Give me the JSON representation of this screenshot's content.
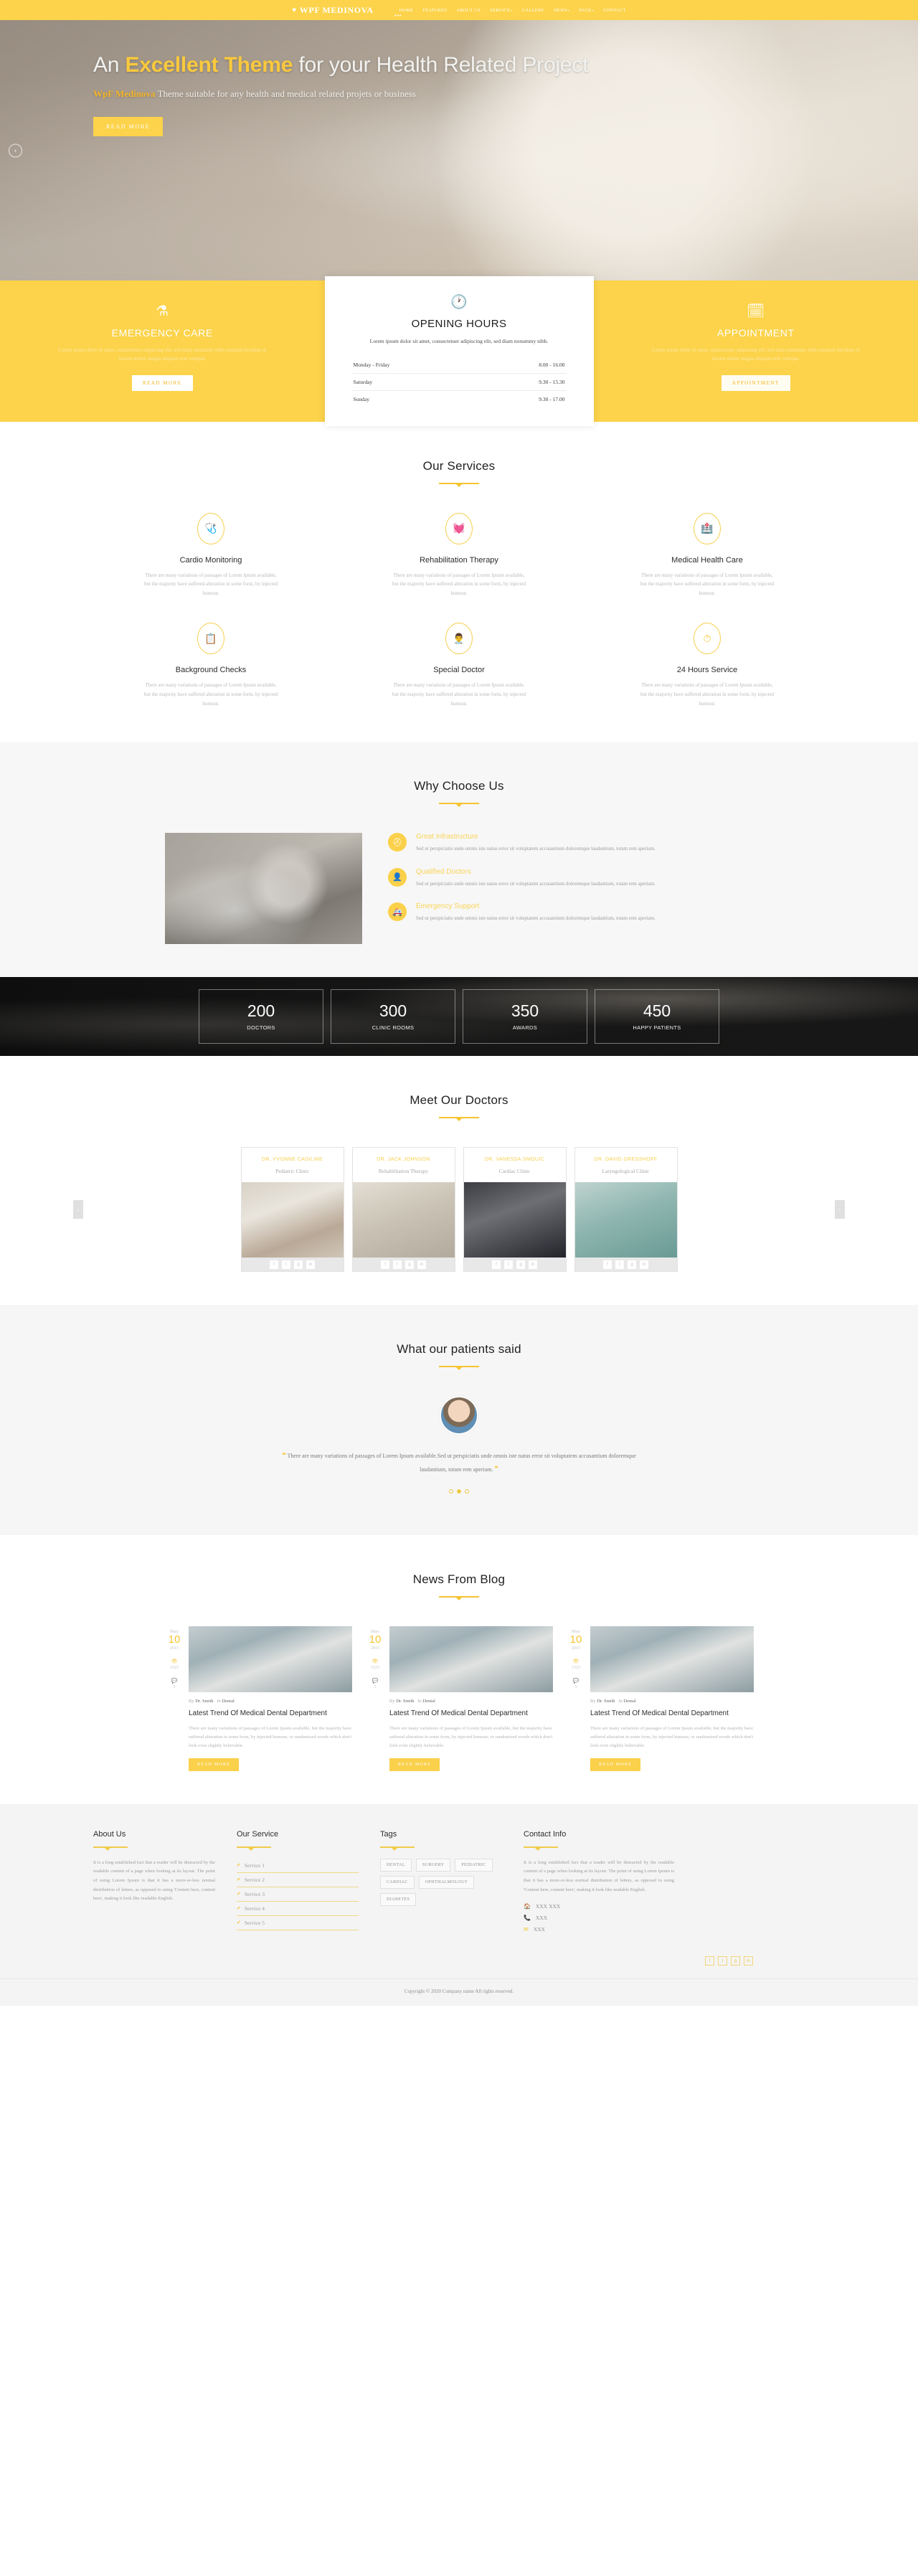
{
  "header": {
    "brand": "WPF MEDINOVA",
    "brand_icon": "heart-pulse-icon",
    "nav": [
      {
        "label": "HOME",
        "caret": false
      },
      {
        "label": "FEATURES",
        "caret": false
      },
      {
        "label": "ABOUT US",
        "caret": false
      },
      {
        "label": "SERVICE",
        "caret": true
      },
      {
        "label": "GALLERY",
        "caret": false
      },
      {
        "label": "NEWS",
        "caret": true
      },
      {
        "label": "PAGE",
        "caret": true
      },
      {
        "label": "CONTACT",
        "caret": false
      }
    ],
    "dots": "•••"
  },
  "hero": {
    "title_pre": "An ",
    "title_hl": "Excellent Theme",
    "title_post": " for your Health Related Project",
    "sub_hl": "WpF Medinova",
    "sub_rest": " Theme suitable for any health and medical related projets or business",
    "cta": "READ MORE",
    "prev_arrow": "‹"
  },
  "info": {
    "emergency": {
      "icon": "flask-icon",
      "title": "EMERGENCY CARE",
      "text": "Lorem ipsum dolor sit amet, consectetuer adipiscing elit, sed diam nonummy nibh euismod tincidunt ut laoreet dolore magna aliquam erat volutpat.",
      "button": "READ MORE"
    },
    "hours": {
      "icon": "clock-icon",
      "title": "OPENING HOURS",
      "text": "Lorem ipsum dolor sit amet, consectetuer adipiscing elit, sed diam nonummy nibh.",
      "rows": [
        {
          "day": "Monday - Friday",
          "time": "8.00 - 16.00"
        },
        {
          "day": "Saturday",
          "time": "9.30 - 15.30"
        },
        {
          "day": "Sunday",
          "time": "9.30 - 17.00"
        }
      ]
    },
    "appointment": {
      "icon": "calendar-icon",
      "title": "APPOINTMENT",
      "text": "Lorem ipsum dolor sit amet, consectetuer adipiscing elit, sed diam nonummy nibh euismod tincidunt ut laoreet dolore magna aliquam erat volutpat.",
      "button": "APPOINTMENT"
    }
  },
  "services": {
    "title": "Our Services",
    "items": [
      {
        "icon": "stethoscope-icon",
        "title": "Cardio Monitoring",
        "text": "There are many variations of passages of Lorem Ipsum available, but the majority have suffered alteration in some form, by injected humour."
      },
      {
        "icon": "heartbeat-icon",
        "title": "Rehabilitation Therapy",
        "text": "There are many variations of passages of Lorem Ipsum available, but the majority have suffered alteration in some form, by injected humour."
      },
      {
        "icon": "hospital-icon",
        "title": "Medical Health Care",
        "text": "There are many variations of passages of Lorem Ipsum available, but the majority have suffered alteration in some form, by injected humour."
      },
      {
        "icon": "clipboard-check-icon",
        "title": "Background Checks",
        "text": "There are many variations of passages of Lorem Ipsum available, but the majority have suffered alteration in some form, by injected humour."
      },
      {
        "icon": "user-md-icon",
        "title": "Special Doctor",
        "text": "There are many variations of passages of Lorem Ipsum available, but the majority have suffered alteration in some form, by injected humour."
      },
      {
        "icon": "clock-24-icon",
        "title": "24 Hours Service",
        "text": "There are many variations of passages of Lorem Ipsum available, but the majority have suffered alteration in some form, by injected humour."
      }
    ]
  },
  "why": {
    "title": "Why Choose Us",
    "items": [
      {
        "icon": "first-aid-kit-icon",
        "title": "Great Infrastructure",
        "text": "Sed ut perspiciatis unde omnis iste natus error sit voluptatem accusantium doloremque laudantium, totam rem aperiam."
      },
      {
        "icon": "doctor-badge-icon",
        "title": "Qualified Doctors",
        "text": "Sed ut perspiciatis unde omnis iste natus error sit voluptatem accusantium doloremque laudantium, totam rem aperiam."
      },
      {
        "icon": "ambulance-icon",
        "title": "Emergency Support",
        "text": "Sed ut perspiciatis unde omnis iste natus error sit voluptatem accusantium doloremque laudantium, totam rem aperiam."
      }
    ]
  },
  "counters": [
    {
      "number": "200",
      "label": "DOCTORS"
    },
    {
      "number": "300",
      "label": "CLINIC ROOMS"
    },
    {
      "number": "350",
      "label": "AWARDS"
    },
    {
      "number": "450",
      "label": "HAPPY PATIENTS"
    }
  ],
  "doctors": {
    "title": "Meet Our Doctors",
    "prev": "‹",
    "next": "›",
    "items": [
      {
        "name": "DR. YVONNE CADILINE",
        "specialty": "Pediatric Clinic"
      },
      {
        "name": "DR. JACK JOHNSON",
        "specialty": "Rehabilitation Therapy"
      },
      {
        "name": "DR. VANESSA SMOUIC",
        "specialty": "Cardiac Clinic"
      },
      {
        "name": "DR. DAVID GRESSHOFF",
        "specialty": "Laryngological Clinic"
      }
    ],
    "social": [
      "f",
      "t",
      "g",
      "in"
    ]
  },
  "testimonial": {
    "title": "What our patients said",
    "avatar": "patient-avatar",
    "quote_open": "❝",
    "quote": "There are many variations of passages of Lorem Ipsum available.Sed ut perspiciatis unde omnis iste natus error sit voluptatem accusantium doloremque laudantium, totam rem aperiam.",
    "quote_close": "❞",
    "dots": 3,
    "active_dot": 1
  },
  "blog": {
    "title": "News From Blog",
    "posts": [
      {
        "month": "May",
        "day": "10",
        "year": "2015",
        "views_icon": "eye-icon",
        "views": "1523",
        "comments_icon": "comment-icon",
        "comments": "5",
        "by_label": "By",
        "author": "Dr. Smith",
        "in_label": "In",
        "category": "Dental",
        "title": "Latest Trend Of Medical Dental Department",
        "text": "There are many variations of passages of Lorem Ipsum available, but the majority have suffered alteration in some form, by injected humour, or randomised words which don't look even slightly believable.",
        "button": "READ MORE"
      },
      {
        "month": "May",
        "day": "10",
        "year": "2015",
        "views_icon": "eye-icon",
        "views": "1523",
        "comments_icon": "comment-icon",
        "comments": "5",
        "by_label": "By",
        "author": "Dr. Smith",
        "in_label": "In",
        "category": "Dental",
        "title": "Latest Trend Of Medical Dental Department",
        "text": "There are many variations of passages of Lorem Ipsum available, but the majority have suffered alteration in some form, by injected humour, or randomised words which don't look even slightly believable.",
        "button": "READ MORE"
      },
      {
        "month": "May",
        "day": "10",
        "year": "2015",
        "views_icon": "eye-icon",
        "views": "1523",
        "comments_icon": "comment-icon",
        "comments": "5",
        "by_label": "By",
        "author": "Dr. Smith",
        "in_label": "In",
        "category": "Dental",
        "title": "Latest Trend Of Medical Dental Department",
        "text": "There are many variations of passages of Lorem Ipsum available, but the majority have suffered alteration in some form, by injected humour, or randomised words which don't look even slightly believable.",
        "button": "READ MORE"
      }
    ]
  },
  "footer": {
    "about": {
      "title": "About Us",
      "text": "It is a long established fact that a reader will be distracted by the readable content of a page when looking at its layout. The point of using Lorem Ipsum is that it has a more-or-less normal distribution of letters, as opposed to using 'Content here, content here', making it look like readable English."
    },
    "service": {
      "title": "Our Service",
      "items": [
        "Service 1",
        "Service 2",
        "Service 3",
        "Service 4",
        "Service 5"
      ]
    },
    "tags": {
      "title": "Tags",
      "items": [
        "DENTAL",
        "SURGERY",
        "PEDIATRIC",
        "CARDIAC",
        "OPHTHALMOLOGY",
        "DIABETES"
      ]
    },
    "contact": {
      "title": "Contact Info",
      "rows": [
        {
          "icon": "home-icon",
          "value": "XXX XXX"
        },
        {
          "icon": "phone-icon",
          "value": "XXX"
        },
        {
          "icon": "mail-icon",
          "value": "XXX"
        }
      ]
    },
    "social": [
      "f",
      "t",
      "g",
      "in"
    ],
    "copyright": "Copyright © 2020 Company name All rights reserved."
  },
  "colors": {
    "accent": "#fcd34a",
    "accent_dark": "#f5c430",
    "dark": "#1a1a1a"
  }
}
